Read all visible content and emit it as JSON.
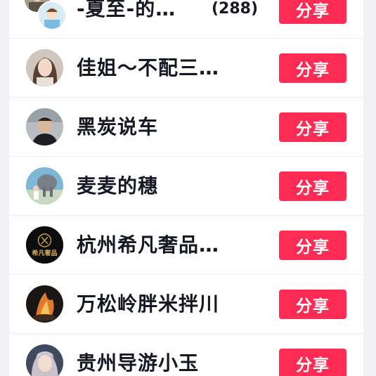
{
  "share_label": "分享",
  "rows": [
    {
      "name": "-夏至-的…",
      "count": "(288)"
    },
    {
      "name": "佳姐～不配三…"
    },
    {
      "name": "黑炭说车"
    },
    {
      "name": "麦麦的穗"
    },
    {
      "name": "杭州希凡奢品…"
    },
    {
      "name": "万松岭胖米拌川"
    },
    {
      "name": "贵州导游小玉"
    }
  ],
  "avatar_texts": {
    "luxury_logo": "希凡奢品"
  },
  "colors": {
    "share_button": "#fe2c55",
    "name_text": "#161823",
    "background": "#f2f2f4"
  }
}
